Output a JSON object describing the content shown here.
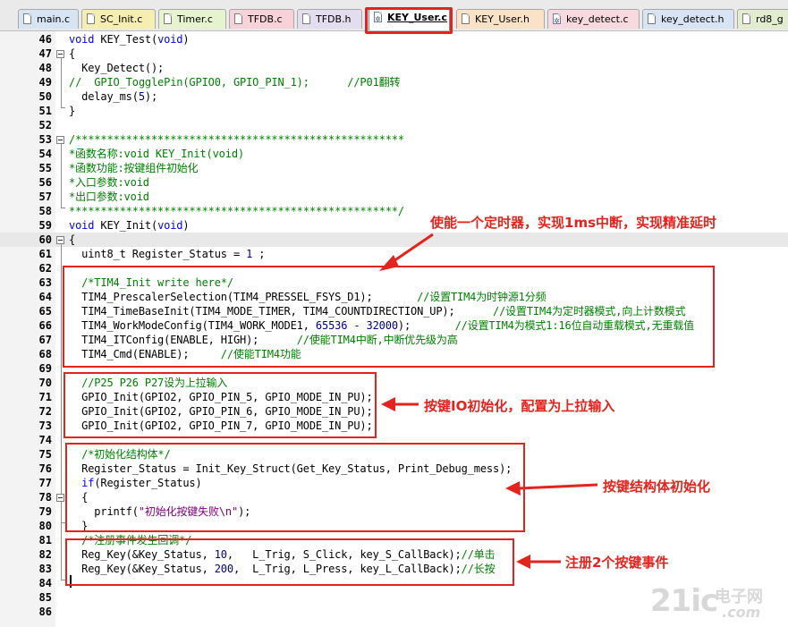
{
  "tabs": [
    {
      "label": "main.c",
      "icon": "file-icon"
    },
    {
      "label": "SC_Init.c",
      "icon": "file-icon"
    },
    {
      "label": "Timer.c",
      "icon": "file-icon"
    },
    {
      "label": "TFDB.c",
      "icon": "file-icon"
    },
    {
      "label": "TFDB.h",
      "icon": "file-icon"
    },
    {
      "label": "KEY_User.c",
      "icon": "gear-file-icon",
      "active": true
    },
    {
      "label": "KEY_User.h",
      "icon": "file-icon"
    },
    {
      "label": "key_detect.c",
      "icon": "gear-file-icon"
    },
    {
      "label": "key_detect.h",
      "icon": "file-icon"
    },
    {
      "label": "rd8_g",
      "icon": "file-icon"
    }
  ],
  "line_numbers": [
    "46",
    "47",
    "48",
    "49",
    "50",
    "51",
    "52",
    "53",
    "54",
    "55",
    "56",
    "57",
    "58",
    "59",
    "60",
    "61",
    "62",
    "63",
    "64",
    "65",
    "66",
    "67",
    "68",
    "69",
    "70",
    "71",
    "72",
    "73",
    "74",
    "75",
    "76",
    "77",
    "78",
    "79",
    "80",
    "81",
    "82",
    "83",
    "84",
    "85",
    "86"
  ],
  "code": {
    "l46": {
      "kw": "void",
      "rest": " KEY_Test(",
      "kw2": "void",
      "end": ")"
    },
    "l47": "{",
    "l48": "  Key_Detect();",
    "l49": "//  GPIO_TogglePin(GPIO0, GPIO_PIN_1);      //P01翻转",
    "l50": {
      "pre": "  delay_ms(",
      "num": "5",
      "post": ");"
    },
    "l51": "}",
    "l53": "/****************************************************",
    "l54": "*函数名称:void KEY_Init(void)",
    "l55": "*函数功能:按键组件初始化",
    "l56": "*入口参数:void",
    "l57": "*出口参数:void",
    "l58": "****************************************************/",
    "l59": {
      "kw": "void",
      "rest": " KEY_Init(",
      "kw2": "void",
      "end": ")"
    },
    "l60": "{",
    "l61": {
      "pre": "  uint8_t Register_Status = ",
      "num": "1",
      "post": " ;"
    },
    "l63": "  /*TIM4_Init write here*/",
    "l64": {
      "code": "  TIM4_PrescalerSelection(TIM4_PRESSEL_FSYS_D1);       ",
      "cm": "//设置TIM4为时钟源1分频"
    },
    "l65": {
      "code": "  TIM4_TimeBaseInit(TIM4_MODE_TIMER, TIM4_COUNTDIRECTION_UP);      ",
      "cm": "//设置TIM4为定时器模式,向上计数模式"
    },
    "l66": {
      "pre": "  TIM4_WorkModeConfig(TIM4_WORK_MODE1, ",
      "num": "65536 - 32000",
      "post": ");       ",
      "cm": "//设置TIM4为模式1:16位自动重载模式,无重载值"
    },
    "l67": {
      "code": "  TIM4_ITConfig(ENABLE, HIGH);      ",
      "cm": "//使能TIM4中断,中断优先级为高"
    },
    "l68": {
      "code": "  TIM4_Cmd(ENABLE);     ",
      "cm": "//使能TIM4功能"
    },
    "l70": "  //P25 P26 P27设为上拉输入",
    "l71": "  GPIO_Init(GPIO2, GPIO_PIN_5, GPIO_MODE_IN_PU);",
    "l72": "  GPIO_Init(GPIO2, GPIO_PIN_6, GPIO_MODE_IN_PU);",
    "l73": "  GPIO_Init(GPIO2, GPIO_PIN_7, GPIO_MODE_IN_PU);",
    "l75": "  /*初始化结构体*/",
    "l76": "  Register_Status = Init_Key_Struct(Get_Key_Status, Print_Debug_mess);",
    "l77": {
      "kw": "  if",
      "rest": "(Register_Status)"
    },
    "l78": "  {",
    "l79": {
      "pre": "    printf(",
      "str": "\"初始化按键失败\\n\"",
      "post": ");"
    },
    "l80": "  }",
    "l81": "  /*注册事件发生回调*/",
    "l82": {
      "pre": "  Reg_Key(&Key_Status, ",
      "num": "10",
      "post": ",   L_Trig, S_Click, key_S_CallBack);",
      "cm": "//单击"
    },
    "l83": {
      "pre": "  Reg_Key(&Key_Status, ",
      "num": "200",
      "post": ",  L_Trig, L_Press, key_L_CallBack);",
      "cm": "//长按"
    }
  },
  "annotations": {
    "timer": "使能一个定时器，实现1ms中断，实现精准延时",
    "gpio": "按键IO初始化，配置为上拉输入",
    "struct": "按键结构体初始化",
    "register": "注册2个按键事件"
  },
  "watermark": {
    "brand": "21ic",
    "cn": "电子网",
    "domain": ".com"
  },
  "colors": {
    "annotation": "#e3231d",
    "keyword": "#0000ff",
    "comment": "#008000",
    "string": "#800080"
  }
}
